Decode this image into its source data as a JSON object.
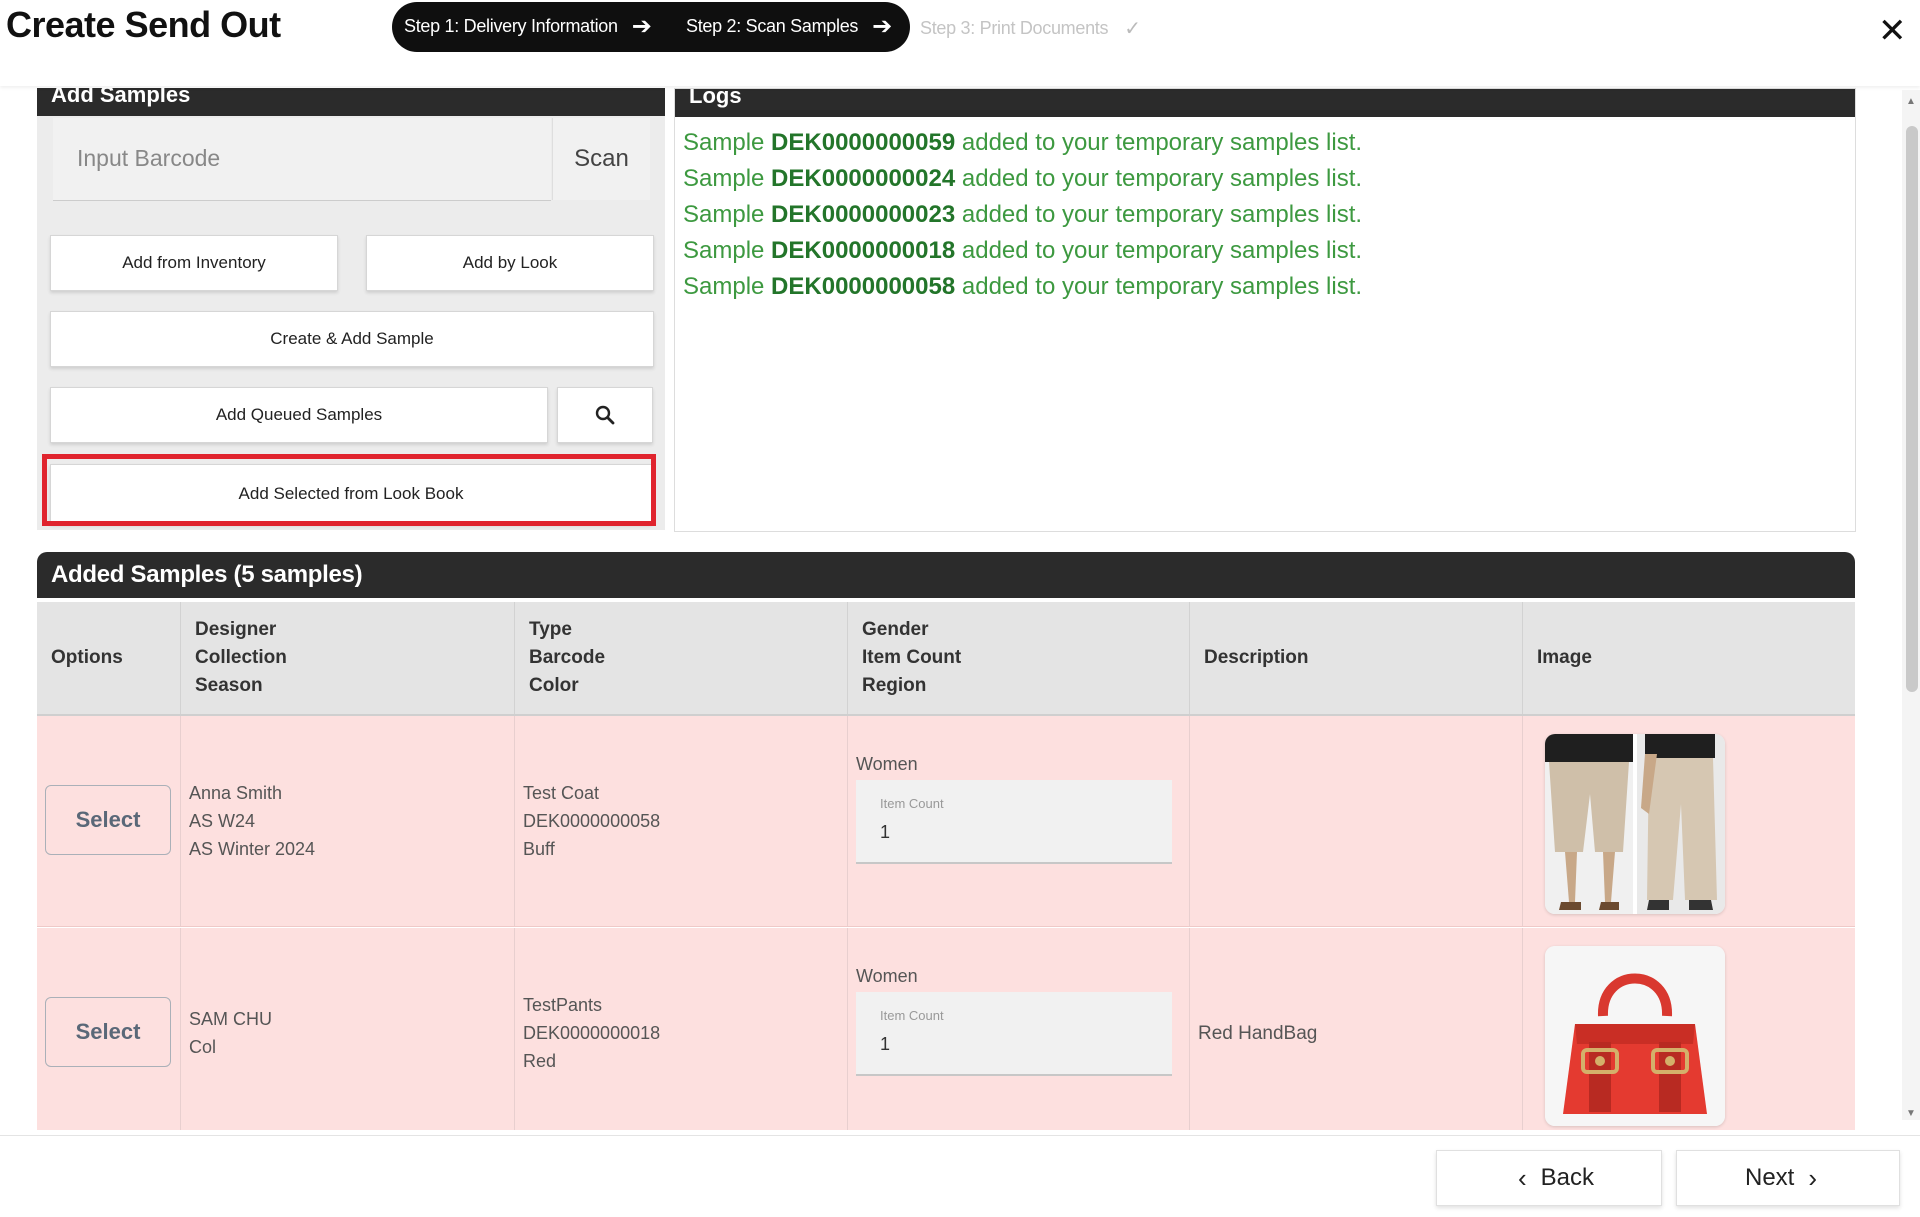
{
  "header": {
    "title": "Create Send Out",
    "steps": [
      {
        "label": "Step 1: Delivery Information",
        "icon": "arrow-right-icon"
      },
      {
        "label": "Step 2: Scan Samples",
        "icon": "arrow-right-icon"
      },
      {
        "label": "Step 3: Print Documents",
        "icon": "check-icon"
      }
    ],
    "close_glyph": "✕"
  },
  "add_samples": {
    "title": "Add Samples",
    "barcode_placeholder": "Input Barcode",
    "scan_label": "Scan",
    "add_from_inventory": "Add from Inventory",
    "add_by_look": "Add by Look",
    "create_add_sample": "Create & Add Sample",
    "add_queued_samples": "Add Queued Samples",
    "add_selected_lookbook": "Add Selected from Look Book"
  },
  "logs": {
    "title": "Logs",
    "lines": [
      {
        "prefix": "Sample ",
        "id": "DEK0000000059",
        "suffix": " added to your temporary samples list."
      },
      {
        "prefix": "Sample ",
        "id": "DEK0000000024",
        "suffix": " added to your temporary samples list."
      },
      {
        "prefix": "Sample ",
        "id": "DEK0000000023",
        "suffix": " added to your temporary samples list."
      },
      {
        "prefix": "Sample ",
        "id": "DEK0000000018",
        "suffix": " added to your temporary samples list."
      },
      {
        "prefix": "Sample ",
        "id": "DEK0000000058",
        "suffix": " added to your temporary samples list."
      }
    ]
  },
  "added_samples": {
    "title": "Added Samples (5 samples)",
    "columns": {
      "options": "Options",
      "c2": [
        "Designer",
        "Collection",
        "Season"
      ],
      "c3": [
        "Type",
        "Barcode",
        "Color"
      ],
      "c4": [
        "Gender",
        "Item Count",
        "Region"
      ],
      "description": "Description",
      "image": "Image"
    },
    "rows": [
      {
        "select": "Select",
        "designer": "Anna Smith",
        "collection": "AS W24",
        "season": "AS Winter 2024",
        "type": "Test Coat",
        "barcode": "DEK0000000058",
        "color": "Buff",
        "gender": "Women",
        "count_label": "Item Count",
        "count": "1",
        "description": "",
        "image": "trousers-photo"
      },
      {
        "select": "Select",
        "designer": "SAM CHU",
        "collection": "Col",
        "season": "",
        "type": "TestPants",
        "barcode": "DEK0000000018",
        "color": "Red",
        "gender": "Women",
        "count_label": "Item Count",
        "count": "1",
        "description": "Red HandBag",
        "image": "red-handbag-photo"
      }
    ]
  },
  "footer": {
    "back_label": "Back",
    "next_label": "Next"
  }
}
